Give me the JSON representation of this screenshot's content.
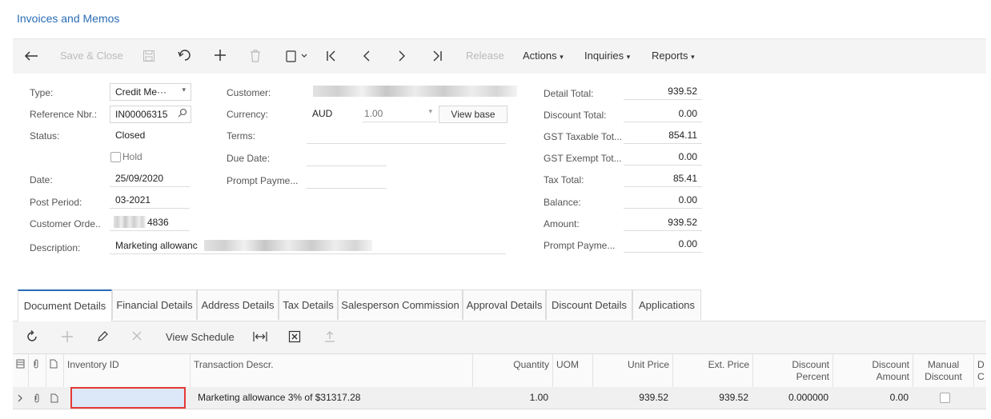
{
  "page": {
    "title": "Invoices and Memos"
  },
  "toolbar": {
    "save_close": "Save & Close",
    "release": "Release",
    "actions": "Actions",
    "inquiries": "Inquiries",
    "reports": "Reports"
  },
  "form": {
    "type_label": "Type:",
    "type_value": "Credit Me···",
    "refnbr_label": "Reference Nbr.:",
    "refnbr_value": "IN00006315",
    "status_label": "Status:",
    "status_value": "Closed",
    "hold_label": "Hold",
    "date_label": "Date:",
    "date_value": "25/09/2020",
    "postperiod_label": "Post Period:",
    "postperiod_value": "03-2021",
    "custorder_label": "Customer Orde..",
    "custorder_value": "4836",
    "description_label": "Description:",
    "description_value": "Marketing allowanc",
    "customer_label": "Customer:",
    "currency_label": "Currency:",
    "currency_value": "AUD",
    "rate_value": "1.00",
    "view_base": "View base",
    "terms_label": "Terms:",
    "duedate_label": "Due Date:",
    "promptpay_label": "Prompt Payme..."
  },
  "totals": {
    "detail_total_label": "Detail Total:",
    "detail_total": "939.52",
    "discount_total_label": "Discount Total:",
    "discount_total": "0.00",
    "gst_taxable_label": "GST Taxable Tot...",
    "gst_taxable": "854.11",
    "gst_exempt_label": "GST Exempt Tot...",
    "gst_exempt": "0.00",
    "tax_total_label": "Tax Total:",
    "tax_total": "85.41",
    "balance_label": "Balance:",
    "balance": "0.00",
    "amount_label": "Amount:",
    "amount": "939.52",
    "prompt_pay_label": "Prompt Payme...",
    "prompt_pay": "0.00"
  },
  "tabs": [
    "Document Details",
    "Financial Details",
    "Address Details",
    "Tax Details",
    "Salesperson Commission",
    "Approval Details",
    "Discount Details",
    "Applications"
  ],
  "gridbar": {
    "view_schedule": "View Schedule"
  },
  "grid": {
    "columns": {
      "inventory_id": "Inventory ID",
      "transaction_descr": "Transaction Descr.",
      "quantity": "Quantity",
      "uom": "UOM",
      "unit_price": "Unit Price",
      "ext_price": "Ext. Price",
      "discount_percent": "Discount\nPercent",
      "discount_amount": "Discount\nAmount",
      "manual_discount": "Manual\nDiscount",
      "last": "D\nC"
    },
    "rows": [
      {
        "inventory_id": "",
        "transaction_descr": "Marketing allowance 3% of $31317.28",
        "quantity": "1.00",
        "uom": "",
        "unit_price": "939.52",
        "ext_price": "939.52",
        "discount_percent": "0.000000",
        "discount_amount": "0.00"
      }
    ]
  }
}
